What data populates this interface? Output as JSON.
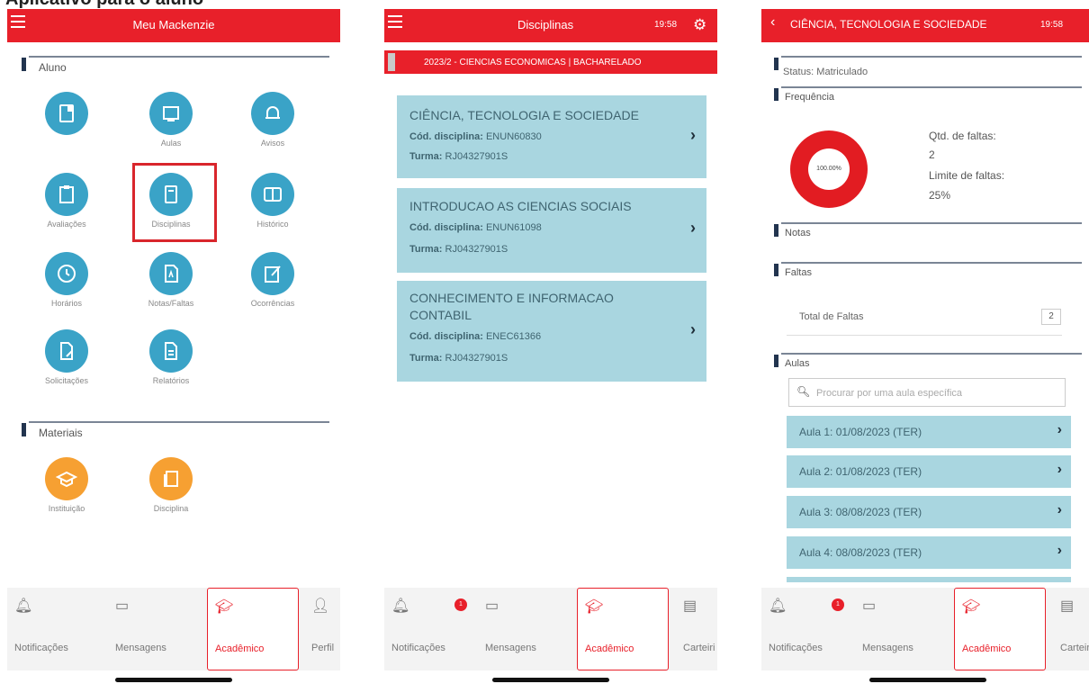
{
  "caption": "Aplicativo para o aluno",
  "screen1": {
    "title": "Meu Mackenzie",
    "aluno_section": "Aluno",
    "aluno_items": [
      "",
      "Aulas",
      "Avisos",
      "Avaliações",
      "Disciplinas",
      "Histórico",
      "Horários",
      "Notas/Faltas",
      "Ocorrências",
      "Solicitações",
      "Relatórios"
    ],
    "materiais_section": "Materiais",
    "materiais_items": [
      "Instituição",
      "Disciplina"
    ],
    "nav": [
      "Notificações",
      "Mensagens",
      "Acadêmico",
      "Perfil"
    ]
  },
  "screen2": {
    "title": "Disciplinas",
    "time": "19:58",
    "subheader": "2023/2 - CIENCIAS ECONOMICAS | BACHARELADO",
    "code_label": "Cód. disciplina:",
    "turma_label": "Turma:",
    "courses": [
      {
        "name": "CIÊNCIA, TECNOLOGIA E SOCIEDADE",
        "code": "ENUN60830",
        "turma": "RJ04327901S"
      },
      {
        "name": "INTRODUCAO AS CIENCIAS SOCIAIS",
        "code": "ENUN61098",
        "turma": "RJ04327901S"
      },
      {
        "name": "CONHECIMENTO E INFORMACAO CONTABIL",
        "code": "ENEC61366",
        "turma": "RJ04327901S"
      }
    ],
    "badge": "1",
    "nav": [
      "Notificações",
      "Mensagens",
      "Acadêmico",
      "Carteiri"
    ]
  },
  "screen3": {
    "title": "CIÊNCIA, TECNOLOGIA E SOCIEDADE",
    "time": "19:58",
    "status": "Status: Matriculado",
    "frequencia": "Frequência",
    "donut_label": "100.00%",
    "faltas_qtd_label": "Qtd. de faltas:",
    "faltas_qtd": "2",
    "limite_label": "Limite de faltas:",
    "limite": "25%",
    "notas": "Notas",
    "faltas": "Faltas",
    "total_faltas_label": "Total de Faltas",
    "total_faltas": "2",
    "aulas": "Aulas",
    "search_placeholder": "Procurar por uma aula específica",
    "aula_list": [
      "Aula 1: 01/08/2023 (TER)",
      "Aula 2: 01/08/2023 (TER)",
      "Aula 3: 08/08/2023 (TER)",
      "Aula 4: 08/08/2023 (TER)"
    ],
    "badge": "1",
    "nav": [
      "Notificações",
      "Mensagens",
      "Acadêmico",
      "Carteir"
    ]
  }
}
